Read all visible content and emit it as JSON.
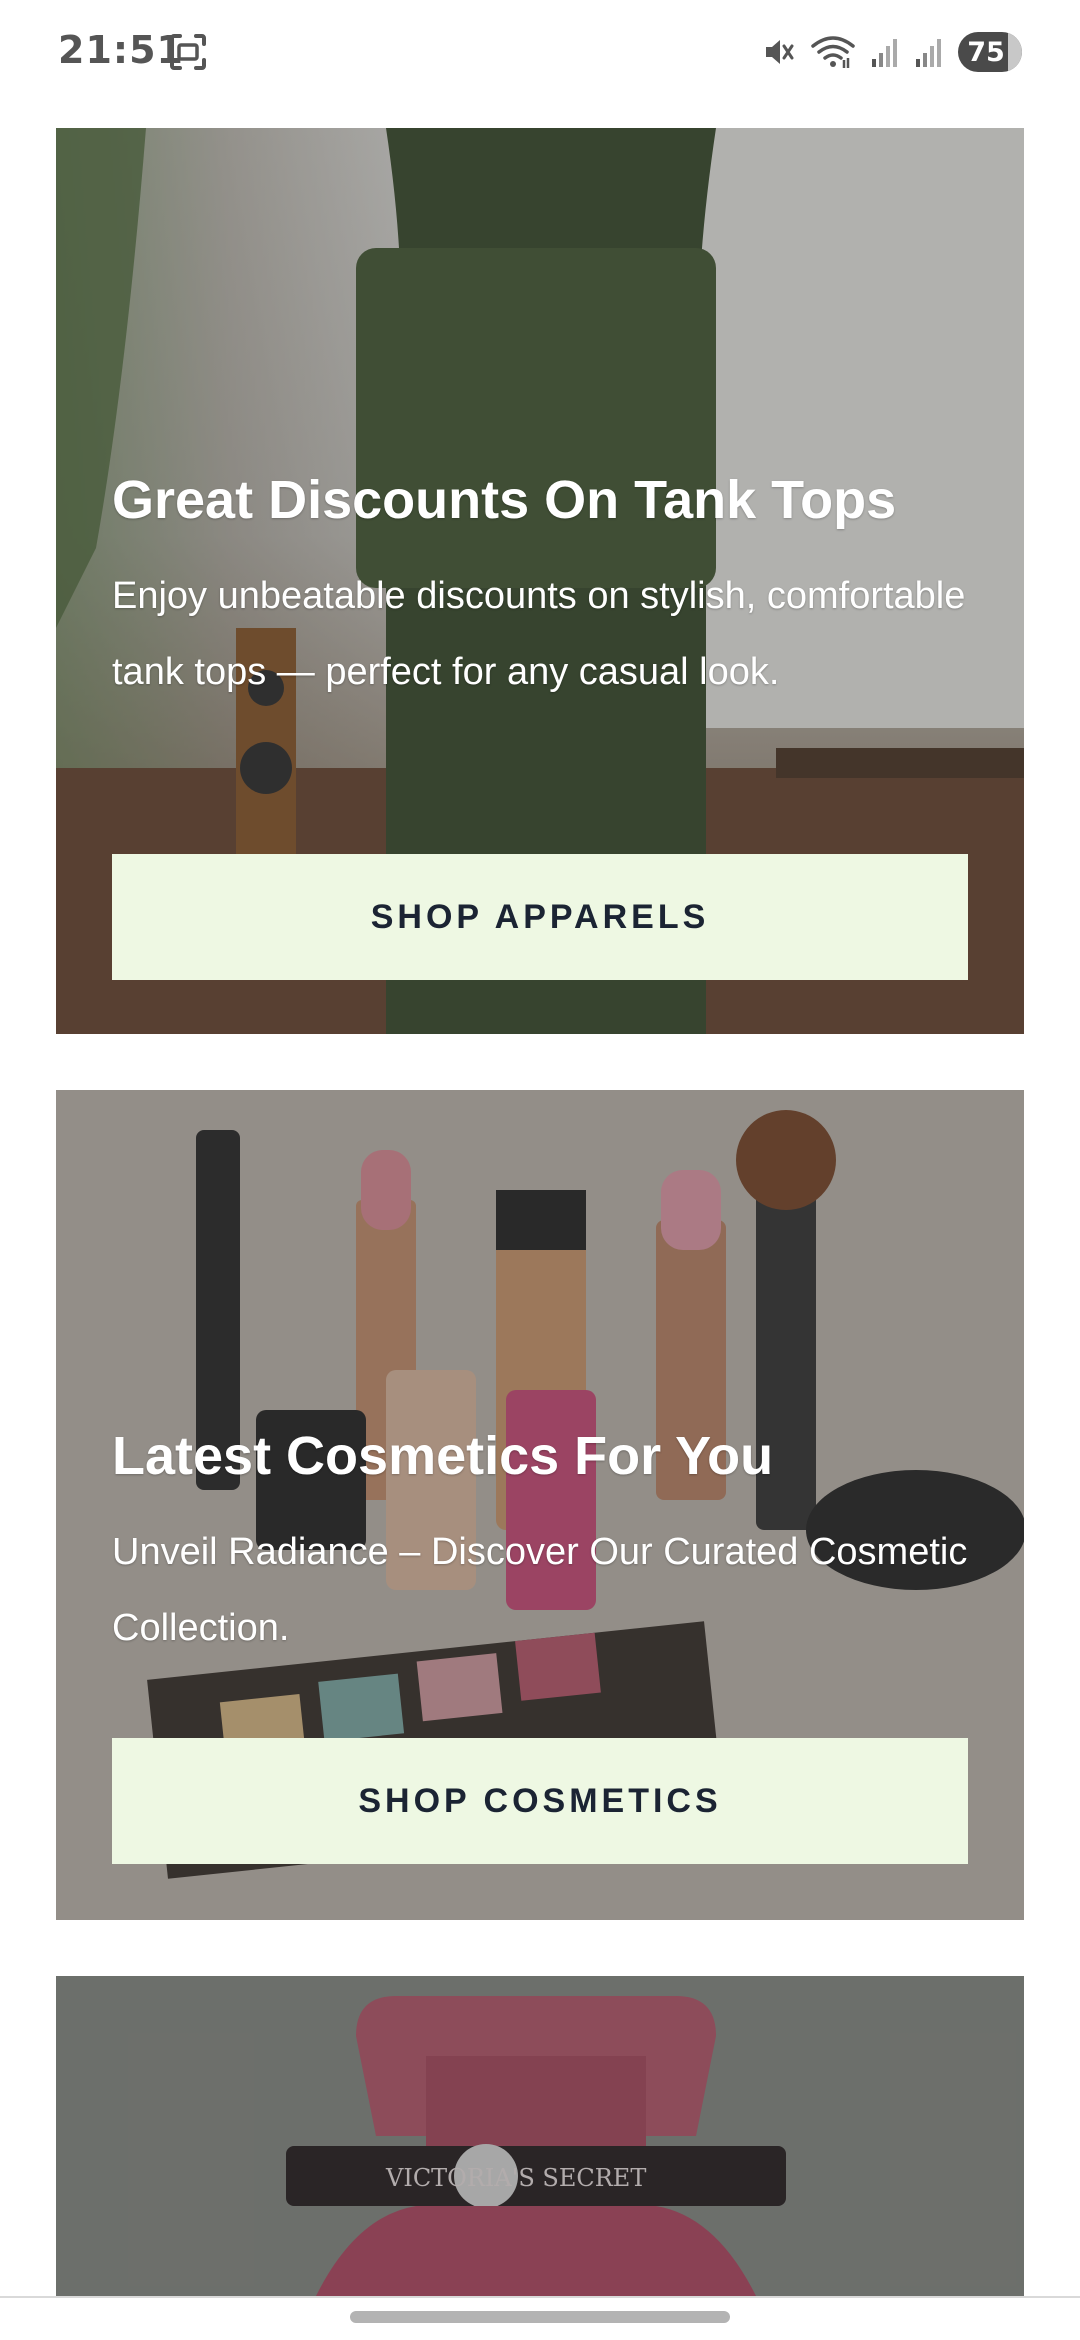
{
  "status_bar": {
    "time": "21:51",
    "battery": "75",
    "icons": [
      "screenshot-icon",
      "mute-icon",
      "wifi-icon",
      "signal-icon",
      "signal-icon"
    ]
  },
  "banners": [
    {
      "title": "Great Discounts On Tank Tops",
      "description": "Enjoy unbeatable discounts on stylish, comfortable tank tops — perfect for any casual look.",
      "button_label": "SHOP APPARELS"
    },
    {
      "title": "Latest Cosmetics For You",
      "description": "Unveil Radiance – Discover Our Curated Cosmetic Collection.",
      "button_label": "SHOP COSMETICS"
    },
    {
      "bottle_text": "VICTORIA'S SECRET"
    }
  ],
  "colors": {
    "button_bg": "#eef8e3",
    "button_text": "#1b2433"
  }
}
